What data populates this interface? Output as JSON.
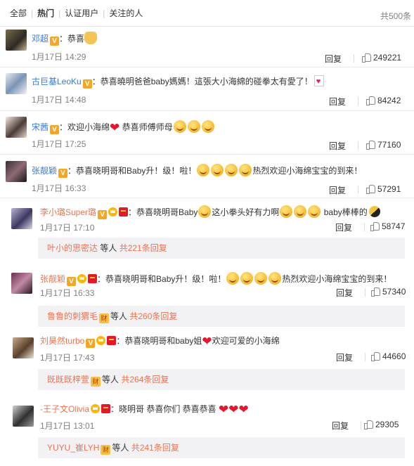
{
  "tabs": [
    {
      "label": "全部"
    },
    {
      "label": "热门"
    },
    {
      "label": "认证用户"
    },
    {
      "label": "关注的人"
    }
  ],
  "total": "共500条",
  "actions": {
    "reply": "回复"
  },
  "comments": [
    {
      "user": "邓超",
      "text": "：恭喜",
      "time": "1月17日 14:29",
      "likes": "249221"
    },
    {
      "user": "古巨基LeoKu",
      "text": "：恭喜曉明爸爸baby媽媽！這張大小海綿的碰拳太有愛了！",
      "time": "1月17日 14:48",
      "likes": "84242"
    },
    {
      "user": "宋茜",
      "text": "：欢迎小海绵",
      "text2": "恭喜师傅师母",
      "time": "1月17日 17:25",
      "likes": "77160"
    },
    {
      "user": "张靓颖",
      "text": "：恭喜晓明哥和Baby升！级！啦！",
      "text2": "热烈欢迎小海绵宝宝的到来！",
      "time": "1月17日 16:33",
      "likes": "57291"
    },
    {
      "user": "李小璐Super璐",
      "text": "：恭喜晓明哥Baby",
      "text2": "这小拳头好有力啊",
      "text3": "baby棒棒的",
      "time": "1月17日 17:10",
      "likes": "58747",
      "sub_name": "叶小的思密达",
      "sub_mid": "等人",
      "sub_count": "共221条回复"
    },
    {
      "user": "张靓颖",
      "text": "：恭喜晓明哥和Baby升！级！啦！",
      "text2": "热烈欢迎小海绵宝宝的到来！",
      "time": "1月17日 16:33",
      "likes": "57340",
      "sub_name": "鲁鲁的刺猬毛",
      "sub_mid": "等人",
      "sub_count": "共260条回复"
    },
    {
      "user": "刘昊然turbo",
      "text": "：恭喜晓明哥和baby姐",
      "text2": "欢迎可爱的小海绵",
      "time": "1月17日 17:43",
      "likes": "44660",
      "sub_name": "既既既梓萱",
      "sub_mid": "等人",
      "sub_count": "共264条回复"
    },
    {
      "user": "-王子文Olivia",
      "text": "：晓明哥 恭喜你们 恭喜恭喜",
      "time": "1月17日 13:01",
      "likes": "29305",
      "sub_name": "YUYU_崔LYH",
      "sub_mid": "等人",
      "sub_count": "共241条回复"
    }
  ],
  "badge_v": "V",
  "fan_badge": "财"
}
